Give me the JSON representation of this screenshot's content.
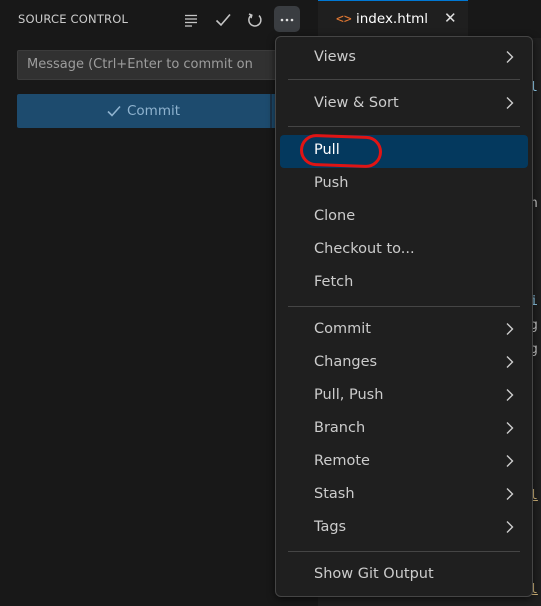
{
  "panel": {
    "title": "SOURCE CONTROL",
    "message_placeholder": "Message (Ctrl+Enter to commit on",
    "commit_label": "Commit"
  },
  "editor": {
    "tab_label": "index.html",
    "code_fragments": [
      "l",
      "n",
      "i",
      "g",
      "g",
      "l",
      "l"
    ]
  },
  "menu": {
    "items": [
      {
        "label": "Views",
        "has_submenu": true
      },
      {
        "label": "View & Sort",
        "has_submenu": true
      },
      {
        "label": "Pull",
        "has_submenu": false,
        "highlighted": true
      },
      {
        "label": "Push",
        "has_submenu": false
      },
      {
        "label": "Clone",
        "has_submenu": false
      },
      {
        "label": "Checkout to...",
        "has_submenu": false
      },
      {
        "label": "Fetch",
        "has_submenu": false
      },
      {
        "label": "Commit",
        "has_submenu": true
      },
      {
        "label": "Changes",
        "has_submenu": true
      },
      {
        "label": "Pull, Push",
        "has_submenu": true
      },
      {
        "label": "Branch",
        "has_submenu": true
      },
      {
        "label": "Remote",
        "has_submenu": true
      },
      {
        "label": "Stash",
        "has_submenu": true
      },
      {
        "label": "Tags",
        "has_submenu": true
      },
      {
        "label": "Show Git Output",
        "has_submenu": false
      }
    ]
  },
  "colors": {
    "accent": "#0078d4",
    "highlight": "#04395e",
    "annotation": "#e01414"
  }
}
